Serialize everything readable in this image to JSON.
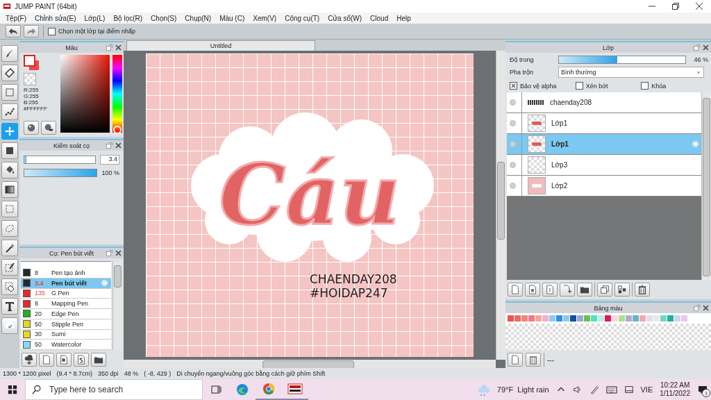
{
  "window": {
    "title": "JUMP PAINT (64bit)"
  },
  "menu": [
    "Tệp(F)",
    "Chỉnh sửa(E)",
    "Lớp(L)",
    "Bộ lọc(R)",
    "Chọn(S)",
    "Chụp(N)",
    "Màu (C)",
    "Xem(V)",
    "Công cụ(T)",
    "Cửa sổ(W)",
    "Cloud",
    "Help"
  ],
  "toolbar": {
    "option": {
      "label": "Chọn một lớp tại điểm nhấp",
      "checked": false
    }
  },
  "tools": [
    {
      "kind": "brush",
      "selected": false
    },
    {
      "kind": "eraser",
      "selected": false
    },
    {
      "kind": "rect",
      "selected": false
    },
    {
      "kind": "line",
      "selected": false
    },
    {
      "kind": "move",
      "selected": true
    },
    {
      "kind": "fill",
      "selected": false
    },
    {
      "kind": "bucket",
      "selected": false
    },
    {
      "kind": "gradient",
      "selected": false
    },
    {
      "kind": "rectselect",
      "selected": false
    },
    {
      "kind": "lasso",
      "selected": false
    },
    {
      "kind": "wand",
      "selected": false
    },
    {
      "kind": "selpen",
      "selected": false
    },
    {
      "kind": "seleraser",
      "selected": false
    },
    {
      "kind": "text",
      "selected": false
    },
    {
      "kind": "cloud",
      "selected": false
    }
  ],
  "color_panel": {
    "title": "Màu",
    "hue": {
      "level": 0
    },
    "readout": [
      "R:255",
      "G:255",
      "B:255",
      "#FFFFFF"
    ]
  },
  "brush_control": {
    "title": "Kiểm soát cọ",
    "size": {
      "level": 0.03,
      "reading": "3.4"
    },
    "density": {
      "level": 1,
      "reading": "100 %"
    }
  },
  "brush_panel": {
    "title": "Cọ: Pen bút viết",
    "brushes": [
      {
        "color": "#282828",
        "size": "8",
        "name": "Pen tạo ảnh",
        "selected": false,
        "size_alert": false
      },
      {
        "color": "#282828",
        "size": "3.4",
        "name": "Pen bút viết",
        "selected": true,
        "size_alert": true
      },
      {
        "color": "#e82828",
        "size": "135",
        "name": "G Pen",
        "selected": false,
        "size_alert": true
      },
      {
        "color": "#e82828",
        "size": "8",
        "name": "Mapping Pen",
        "selected": false,
        "size_alert": false
      },
      {
        "color": "#20b020",
        "size": "20",
        "name": "Edge Pen",
        "selected": false,
        "size_alert": false
      },
      {
        "color": "#e8d820",
        "size": "50",
        "name": "Stipple Pen",
        "selected": false,
        "size_alert": false
      },
      {
        "color": "#e8d820",
        "size": "30",
        "name": "Sumi",
        "selected": false,
        "size_alert": false
      },
      {
        "color": "#88d8f4",
        "size": "50",
        "name": "Watercolor",
        "selected": false,
        "size_alert": false
      }
    ]
  },
  "document": {
    "tab": "Untitled",
    "lettering": "Cáu",
    "lines": [
      "CHAENDAY208",
      "#HOIDAP247"
    ]
  },
  "layer_panel": {
    "title": "Lớp",
    "opacity": {
      "label": "Độ trong",
      "level": 0.46,
      "reading": "46 %"
    },
    "blend": {
      "label": "Pha trộn",
      "value": "Bình thường"
    },
    "options": [
      {
        "label": "Bảo vệ alpha",
        "checked": true
      },
      {
        "label": "Xén bớt",
        "checked": false
      },
      {
        "label": "Khóa",
        "checked": false
      }
    ],
    "layers": [
      {
        "name": "chaenday208",
        "kind": "text",
        "selected": false
      },
      {
        "name": "Lớp1",
        "kind": "lettering",
        "selected": false
      },
      {
        "name": "Lớp1",
        "kind": "lettering",
        "selected": true
      },
      {
        "name": "Lớp3",
        "kind": "blank",
        "selected": false
      },
      {
        "name": "Lớp2",
        "kind": "pink",
        "selected": false
      }
    ]
  },
  "palette_panel": {
    "title": "Bảng màu",
    "footer": "---",
    "swatches": [
      {
        "color": "#f05050"
      },
      {
        "color": "#e07068"
      },
      {
        "color": "#f08878"
      },
      {
        "color": "#f07890"
      },
      {
        "color": "#f4a890"
      },
      {
        "color": "#f4b0c8"
      },
      {
        "color": "#88ccf4"
      },
      {
        "color": "#2c90e8"
      },
      {
        "color": "#98c8e0"
      },
      {
        "color": "#1050a0"
      },
      {
        "color": "#98a8d8"
      },
      {
        "color": "#70c040"
      },
      {
        "color": "#50e0c8"
      },
      {
        "color": "#b8f0e0"
      },
      {
        "color": "#e01860"
      },
      {
        "color": "#f8d8e0"
      },
      {
        "color": "#b0e090"
      },
      {
        "color": "#b8a8d0"
      },
      {
        "color": "#60b8c0"
      },
      {
        "color": "#f4a8b0"
      },
      {
        "color": "#e0e0ec"
      },
      {
        "color": "#e8e8e8"
      },
      {
        "color": "#70d8c0"
      },
      {
        "color": "#20b0a0"
      },
      {
        "color": "#c8d8f4"
      },
      {
        "color": "#ecc8e8"
      }
    ]
  },
  "status_bar": [
    "1300 * 1200 pixel",
    "(9.4 * 8.7cm)",
    "350 dpi",
    "48 %",
    "( -8, 429 )",
    "Di chuyển ngang/vuông góc bằng cách giữ phím Shift"
  ],
  "taskbar": {
    "search_placeholder": "Type here to search",
    "weather": "79°F  Light rain",
    "language": "VIE",
    "time": "10:22 AM",
    "date": "1/11/2022",
    "notifications": "3"
  }
}
